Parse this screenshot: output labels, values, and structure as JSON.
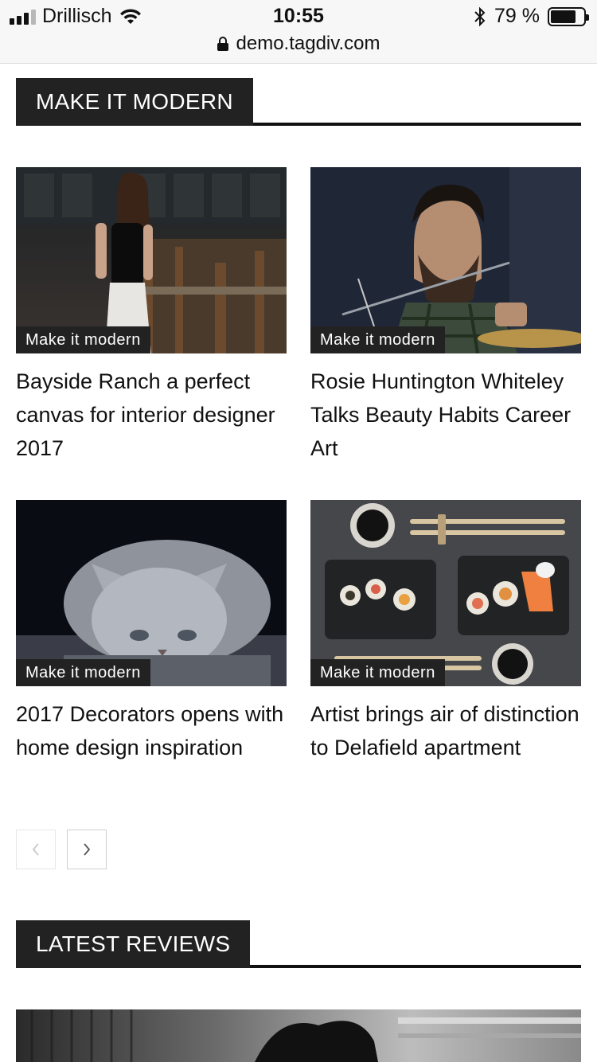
{
  "status_bar": {
    "carrier": "Drillisch",
    "time": "10:55",
    "battery_percent": "79 %",
    "battery_level": 0.79,
    "url": "demo.tagdiv.com",
    "icons": [
      "signal-icon",
      "wifi-icon",
      "bluetooth-icon",
      "battery-icon",
      "lock-icon"
    ]
  },
  "sections": [
    {
      "title": "MAKE IT MODERN"
    },
    {
      "title": "LATEST REVIEWS"
    }
  ],
  "articles": [
    {
      "category": "Make it modern",
      "title": "Bayside Ranch a perfect canvas for interior designer 2017",
      "image": "woman-portrait-photo"
    },
    {
      "category": "Make it modern",
      "title": "Rosie Huntington Whiteley Talks Beauty Habits Career Art",
      "image": "bearded-drummer-photo"
    },
    {
      "category": "Make it modern",
      "title": "2017 Decorators opens with home design inspiration",
      "image": "grey-kitten-photo"
    },
    {
      "category": "Make it modern",
      "title": "Artist brings air of distinction to Delafield apartment",
      "image": "sushi-plates-photo"
    }
  ],
  "pagination": {
    "prev_icon": "chevron-left-icon",
    "next_icon": "chevron-right-icon",
    "prev_disabled": true
  },
  "colors": {
    "header_bg": "#222222",
    "header_text": "#ffffff",
    "rule": "#111111",
    "status_bg": "#f7f7f7"
  }
}
